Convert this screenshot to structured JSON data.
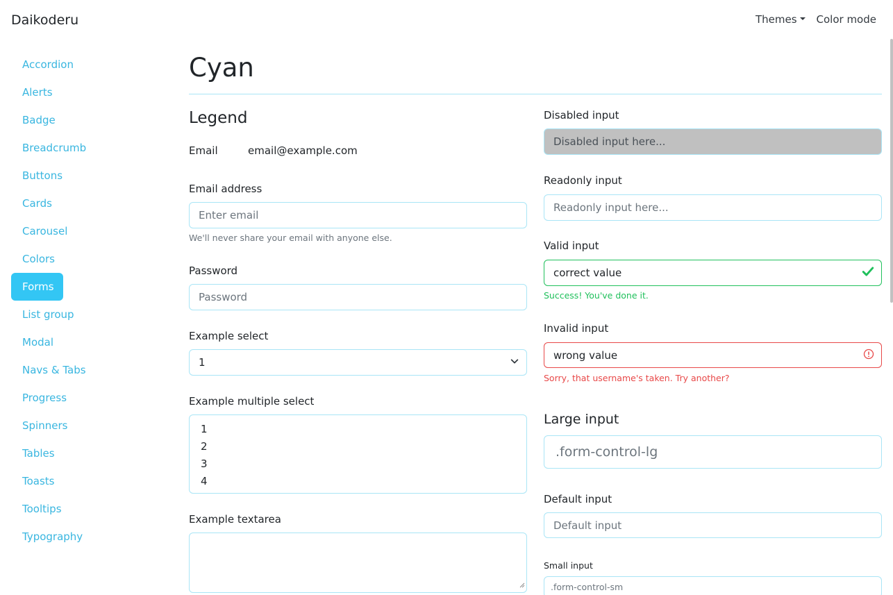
{
  "navbar": {
    "brand": "Daikoderu",
    "themes": "Themes",
    "color_mode": "Color mode"
  },
  "sidebar": {
    "items": [
      {
        "label": "Accordion"
      },
      {
        "label": "Alerts"
      },
      {
        "label": "Badge"
      },
      {
        "label": "Breadcrumb"
      },
      {
        "label": "Buttons"
      },
      {
        "label": "Cards"
      },
      {
        "label": "Carousel"
      },
      {
        "label": "Colors"
      },
      {
        "label": "Forms"
      },
      {
        "label": "List group"
      },
      {
        "label": "Modal"
      },
      {
        "label": "Navs & Tabs"
      },
      {
        "label": "Progress"
      },
      {
        "label": "Spinners"
      },
      {
        "label": "Tables"
      },
      {
        "label": "Toasts"
      },
      {
        "label": "Tooltips"
      },
      {
        "label": "Typography"
      }
    ],
    "active": "Forms"
  },
  "main": {
    "title": "Cyan",
    "legend": "Legend",
    "static_email": {
      "label": "Email",
      "value": "email@example.com"
    },
    "email": {
      "label": "Email address",
      "placeholder": "Enter email",
      "help": "We'll never share your email with anyone else."
    },
    "password": {
      "label": "Password",
      "placeholder": "Password"
    },
    "select": {
      "label": "Example select",
      "value": "1"
    },
    "multi_select": {
      "label": "Example multiple select",
      "options": [
        "1",
        "2",
        "3",
        "4"
      ]
    },
    "textarea": {
      "label": "Example textarea"
    },
    "disabled": {
      "label": "Disabled input",
      "placeholder": "Disabled input here..."
    },
    "readonly": {
      "label": "Readonly input",
      "placeholder": "Readonly input here..."
    },
    "valid": {
      "label": "Valid input",
      "value": "correct value",
      "feedback": "Success! You've done it."
    },
    "invalid": {
      "label": "Invalid input",
      "value": "wrong value",
      "feedback": "Sorry, that username's taken. Try another?"
    },
    "large": {
      "heading": "Large input",
      "placeholder": ".form-control-lg"
    },
    "default": {
      "label": "Default input",
      "placeholder": "Default input"
    },
    "small": {
      "label": "Small input",
      "placeholder": ".form-control-sm"
    }
  },
  "colors": {
    "accent": "#33c6f4",
    "link": "#39b6e0",
    "border": "#a9e5f6",
    "valid": "#20c05c",
    "invalid": "#e84848"
  }
}
